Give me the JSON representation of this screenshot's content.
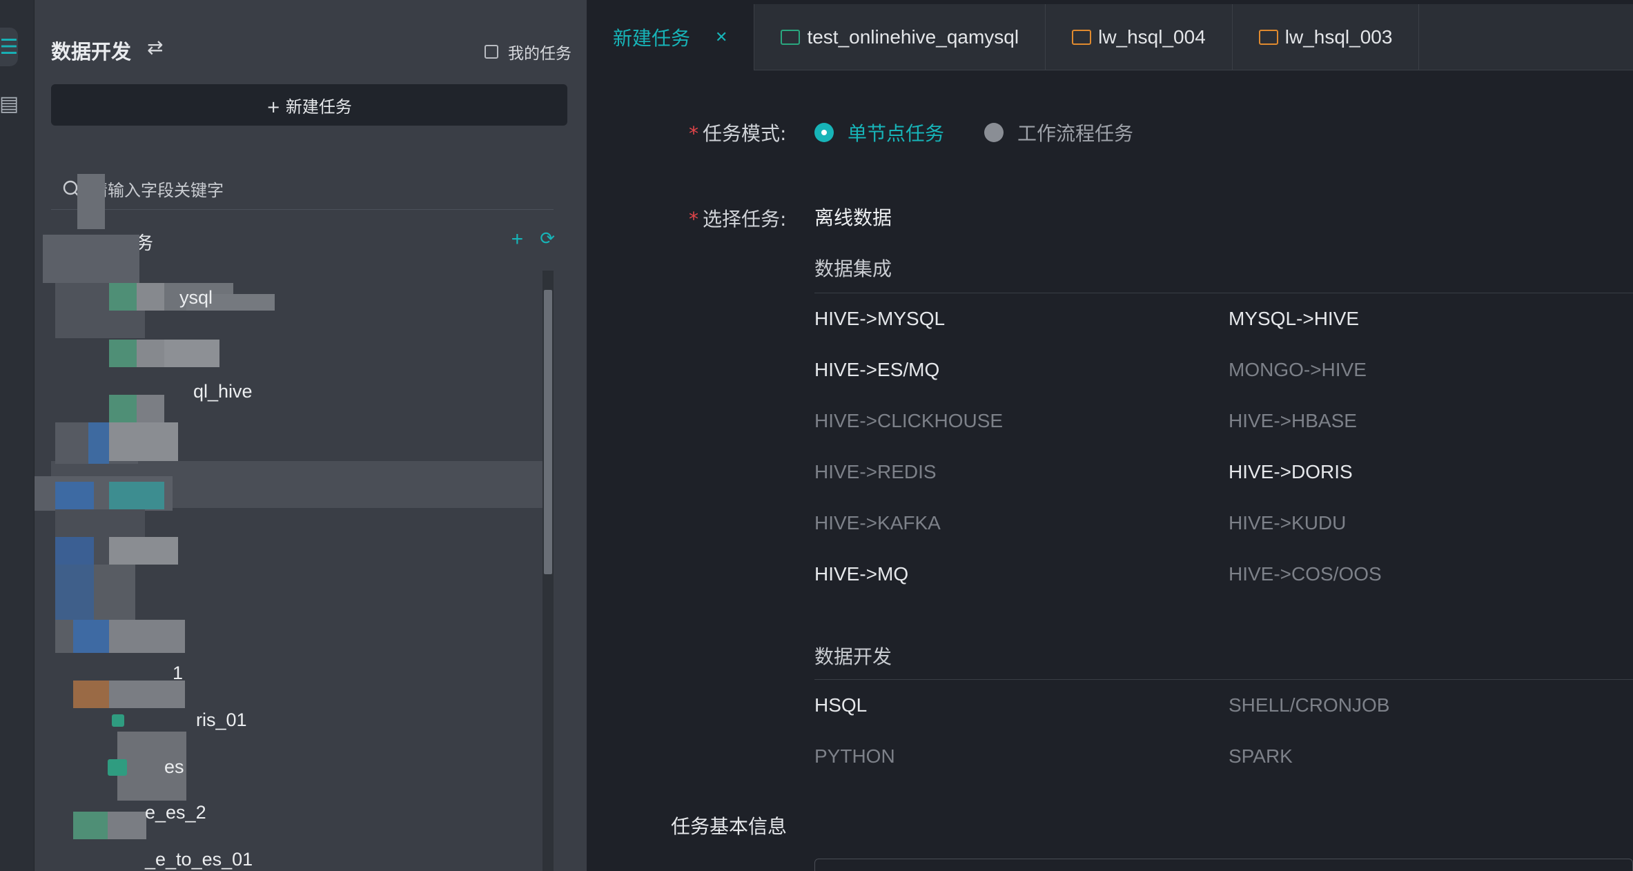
{
  "rail": {
    "items": [
      {
        "icon": "menu-icon",
        "glyph": "☰",
        "active": true
      },
      {
        "icon": "calendar-icon",
        "glyph": "▤",
        "active": false
      }
    ]
  },
  "sidebar": {
    "title": "数据开发",
    "switch_glyph": "⇄",
    "my_tasks_label": "我的任务",
    "new_task_label": "+ 新建任务",
    "search_placeholder": "请输入字段关键字",
    "tree_header_label": "务",
    "tree_items": [
      {
        "label": "ysql",
        "icon": "green"
      },
      {
        "label": "",
        "icon": "green"
      },
      {
        "label": "ql_hive",
        "icon": "green"
      },
      {
        "label": "",
        "icon": "blue"
      },
      {
        "label": "",
        "icon": "blue"
      },
      {
        "label": "",
        "icon": "blue"
      },
      {
        "label": "",
        "icon": "blue"
      },
      {
        "label": "1",
        "icon": "orange"
      },
      {
        "label": "ris_01",
        "icon": "green"
      },
      {
        "label": "es",
        "icon": "green"
      },
      {
        "label": "e_es_2",
        "icon": "green"
      },
      {
        "label": "_e_to_es_01",
        "icon": "green"
      }
    ]
  },
  "tabs": [
    {
      "label": "新建任务",
      "active": true,
      "closable": true,
      "icon": ""
    },
    {
      "label": "test_onlinehive_qamysql",
      "active": false,
      "closable": false,
      "icon": "green"
    },
    {
      "label": "lw_hsql_004",
      "active": false,
      "closable": false,
      "icon": "orange"
    },
    {
      "label": "lw_hsql_003",
      "active": false,
      "closable": false,
      "icon": "orange"
    }
  ],
  "form": {
    "task_mode_label": "任务模式:",
    "task_mode_options": [
      {
        "label": "单节点任务",
        "selected": true
      },
      {
        "label": "工作流程任务",
        "selected": false
      }
    ],
    "select_task_label": "选择任务:",
    "offline_data": "离线数据",
    "integration_title": "数据集成",
    "integration_options": [
      {
        "label": "HIVE->MYSQL",
        "enabled": true
      },
      {
        "label": "MYSQL->HIVE",
        "enabled": true
      },
      {
        "label": "HIVE->ES/MQ",
        "enabled": true
      },
      {
        "label": "MONGO->HIVE",
        "enabled": false
      },
      {
        "label": "HIVE->CLICKHOUSE",
        "enabled": false
      },
      {
        "label": "HIVE->HBASE",
        "enabled": false
      },
      {
        "label": "HIVE->REDIS",
        "enabled": false
      },
      {
        "label": "HIVE->DORIS",
        "enabled": true
      },
      {
        "label": "HIVE->KAFKA",
        "enabled": false
      },
      {
        "label": "HIVE->KUDU",
        "enabled": false
      },
      {
        "label": "HIVE->MQ",
        "enabled": true
      },
      {
        "label": "HIVE->COS/OOS",
        "enabled": false
      }
    ],
    "dev_title": "数据开发",
    "dev_options": [
      {
        "label": "HSQL",
        "enabled": true
      },
      {
        "label": "SHELL/CRONJOB",
        "enabled": false
      },
      {
        "label": "PYTHON",
        "enabled": false
      },
      {
        "label": "SPARK",
        "enabled": false
      }
    ],
    "basic_info_title": "任务基本信息"
  },
  "colors": {
    "accent": "#17b4b8",
    "required": "#e2454a",
    "sidebar_bg": "#3a3e46",
    "main_bg": "#1e2128"
  }
}
